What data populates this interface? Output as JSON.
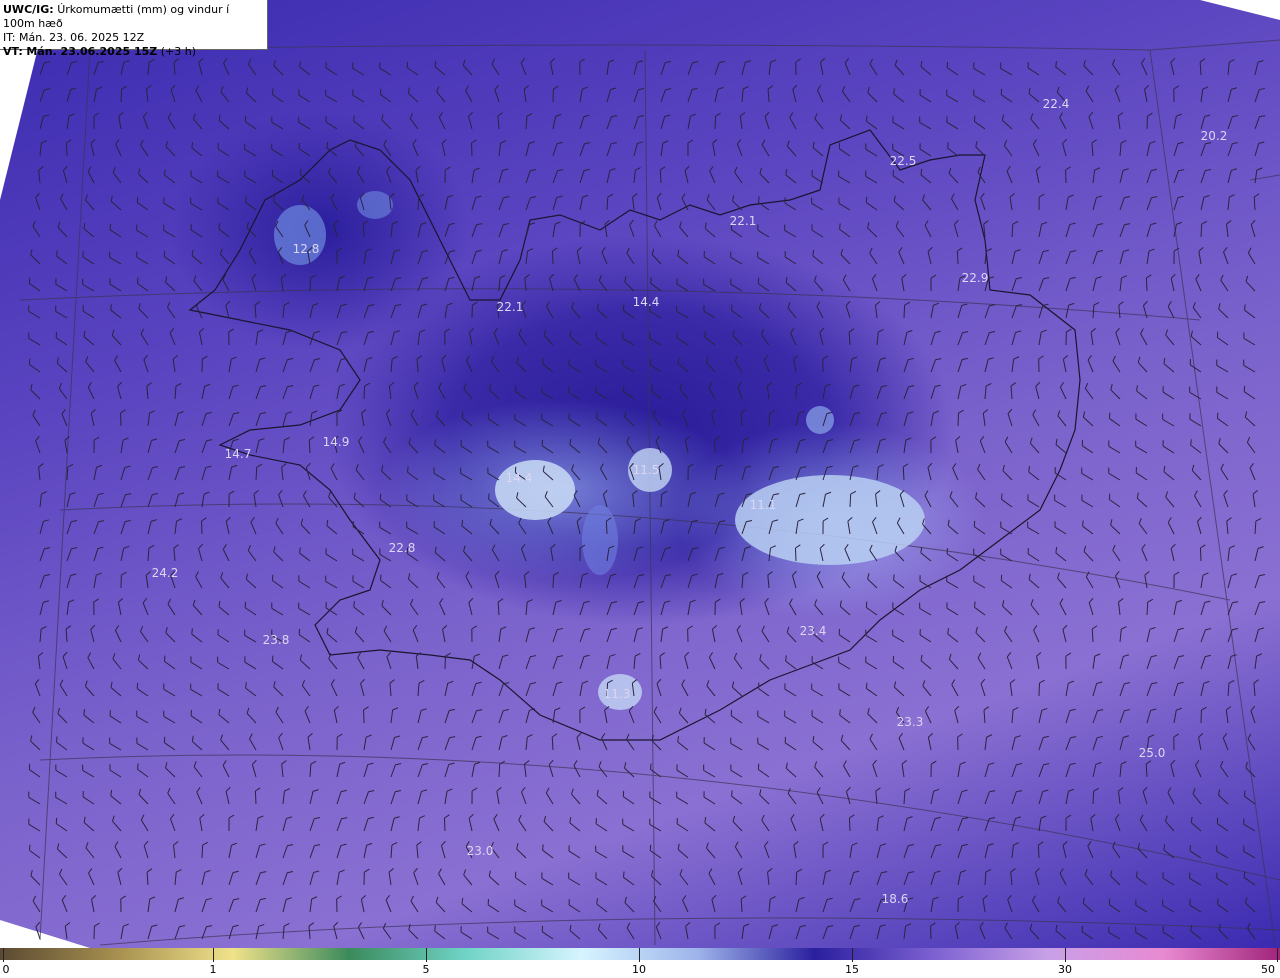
{
  "header": {
    "model_prefix": "UWC/IG:",
    "product": "Úrkomumætti (mm) og vindur í 100m hæð",
    "it_line": "IT: Mán. 23. 06. 2025 12Z",
    "vt_prefix": "VT:",
    "vt_time": "Mán. 23.06.2025 15Z",
    "vt_offset": "(+3 h)"
  },
  "map_values": [
    {
      "name": "map-value-1",
      "text": "22.4"
    },
    {
      "name": "map-value-2",
      "text": "20.2"
    },
    {
      "name": "map-value-3",
      "text": "22.5"
    },
    {
      "name": "map-value-4",
      "text": "22.1"
    },
    {
      "name": "map-value-5",
      "text": "12.8"
    },
    {
      "name": "map-value-6",
      "text": "22.9"
    },
    {
      "name": "map-value-7",
      "text": "22.1"
    },
    {
      "name": "map-value-8",
      "text": "14.4"
    },
    {
      "name": "map-value-9",
      "text": "14.7"
    },
    {
      "name": "map-value-10",
      "text": "14.9"
    },
    {
      "name": "map-value-11",
      "text": "14.4"
    },
    {
      "name": "map-value-12",
      "text": "11.5"
    },
    {
      "name": "map-value-13",
      "text": "11.1"
    },
    {
      "name": "map-value-14",
      "text": "22.8"
    },
    {
      "name": "map-value-15",
      "text": "24.2"
    },
    {
      "name": "map-value-16",
      "text": "23.8"
    },
    {
      "name": "map-value-17",
      "text": "23.4"
    },
    {
      "name": "map-value-18",
      "text": "11.3"
    },
    {
      "name": "map-value-19",
      "text": "23.3"
    },
    {
      "name": "map-value-20",
      "text": "25.0"
    },
    {
      "name": "map-value-21",
      "text": "23.0"
    },
    {
      "name": "map-value-22",
      "text": "18.6"
    }
  ],
  "colorbar": {
    "ticks": [
      "0",
      "1",
      "5",
      "10",
      "15",
      "30",
      "50"
    ],
    "colors": [
      "#5b4a33",
      "#a68f4f",
      "#f0e28a",
      "#3b8a5c",
      "#6fd3c6",
      "#d6f4ff",
      "#9db3ea",
      "#2a1f9e",
      "#7a5fd0",
      "#c8a0e8",
      "#e88ad2",
      "#a0247a"
    ]
  }
}
